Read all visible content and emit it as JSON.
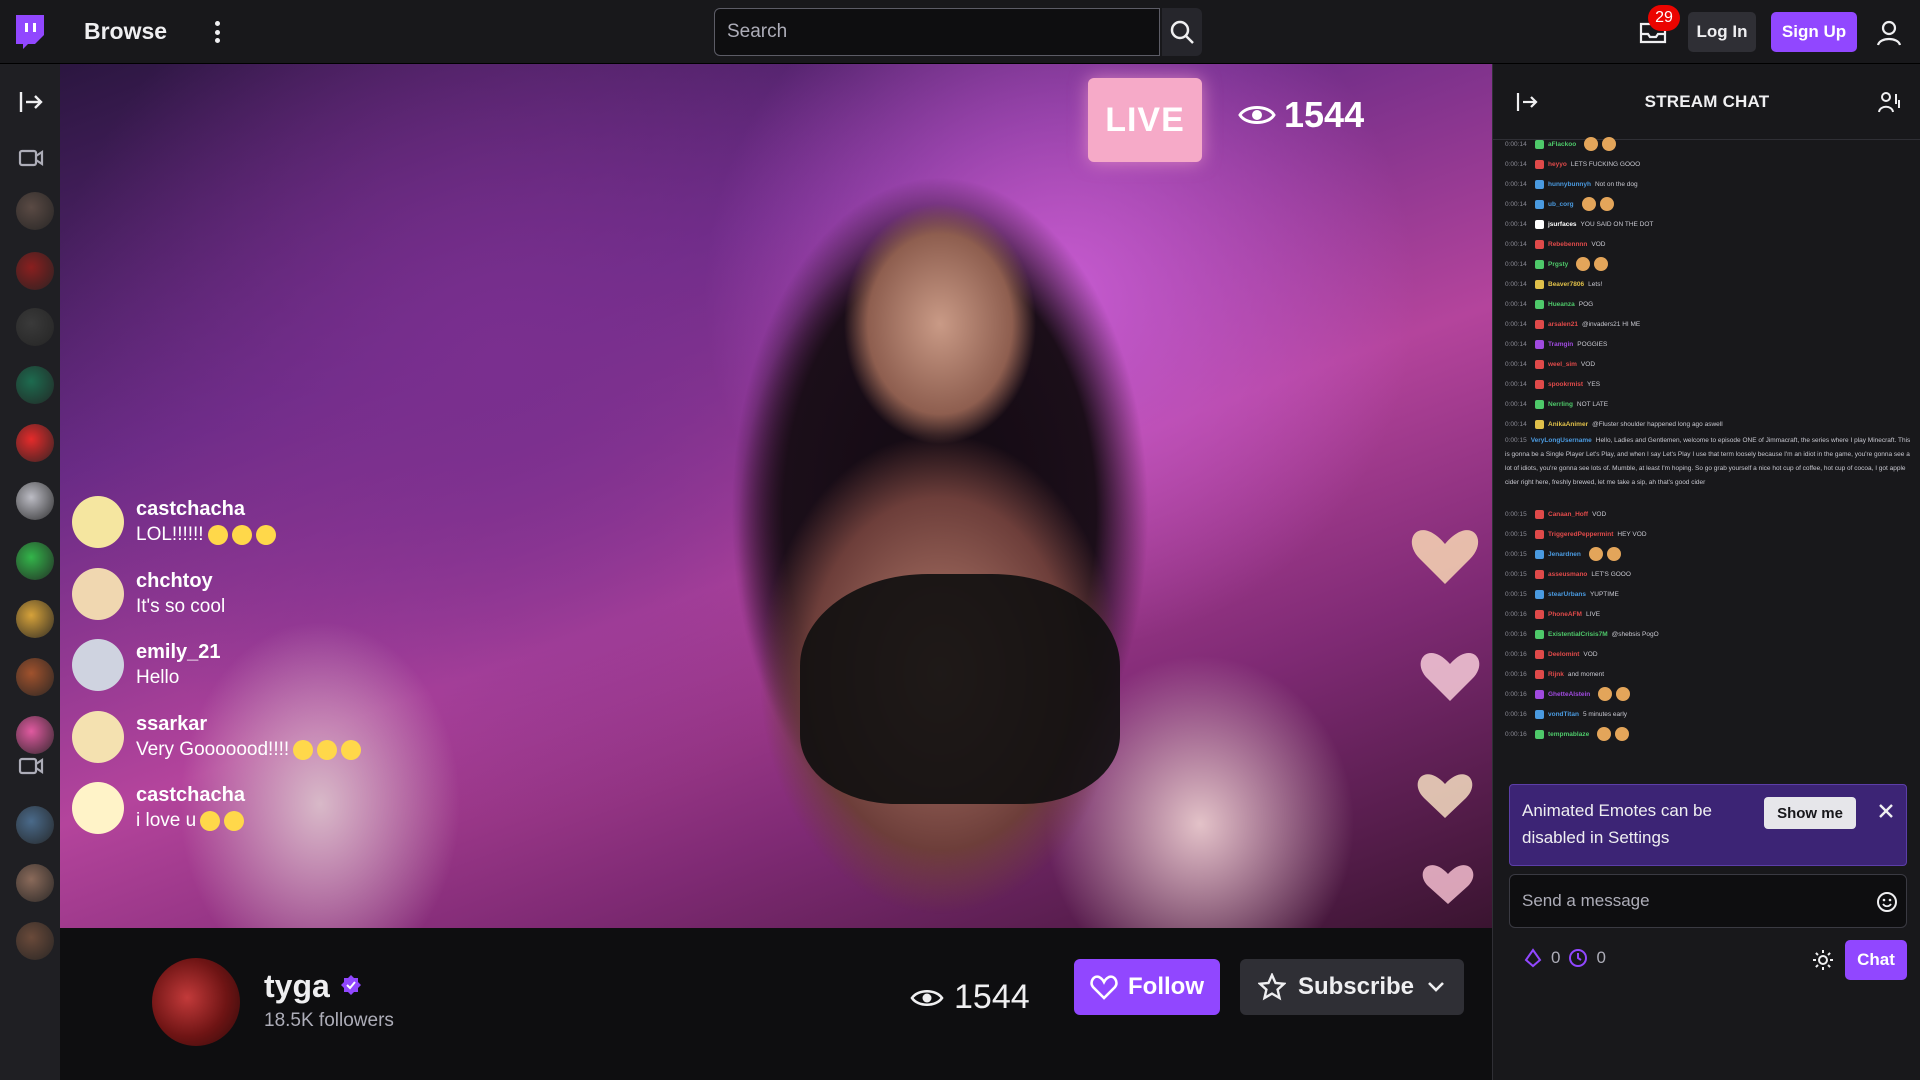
{
  "header": {
    "browse_label": "Browse",
    "search_placeholder": "Search",
    "notification_count": "29",
    "login_label": "Log In",
    "signup_label": "Sign Up"
  },
  "colors": {
    "brand": "#9147ff",
    "live": "#f6aac8",
    "badge": "#eb0400"
  },
  "sidebar": {
    "channels": [
      {
        "name": "channel-1",
        "color": "#5a4a44"
      },
      {
        "name": "channel-2",
        "color": "#8a1f1f"
      },
      {
        "name": "channel-3",
        "color": "#3a3a3a"
      },
      {
        "name": "channel-4",
        "color": "#1d6b4f"
      },
      {
        "name": "channel-5",
        "color": "#e52b2b"
      },
      {
        "name": "channel-6",
        "color": "#bcbcc4"
      },
      {
        "name": "channel-7",
        "color": "#33b54a"
      },
      {
        "name": "channel-8",
        "color": "#d6a23a"
      },
      {
        "name": "channel-9",
        "color": "#a0522d"
      },
      {
        "name": "channel-10",
        "color": "#e05aa0"
      },
      {
        "name": "channel-11",
        "color": "#4a6a8a"
      },
      {
        "name": "channel-12",
        "color": "#8a6a5a"
      },
      {
        "name": "channel-13",
        "color": "#6a4a3a"
      }
    ]
  },
  "video": {
    "live_label": "LIVE",
    "viewer_count": "1544",
    "overlay_chat": [
      {
        "user": "castchacha",
        "message": "LOL!!!!!!",
        "emotes": 3,
        "avatar": "#f5e6a0"
      },
      {
        "user": "chchtoy",
        "message": "It's so cool",
        "emotes": 0,
        "avatar": "#f0d7b0"
      },
      {
        "user": "emily_21",
        "message": "Hello",
        "emotes": 0,
        "avatar": "#cfd3e0"
      },
      {
        "user": "ssarkar",
        "message": "Very Gooooood!!!!",
        "emotes": 3,
        "avatar": "#f4e1b0"
      },
      {
        "user": "castchacha",
        "message": "i love u",
        "emotes": 2,
        "avatar": "#fff3c8"
      }
    ]
  },
  "streamer": {
    "name": "tyga",
    "followers": "18.5K followers",
    "viewer_count": "1544",
    "follow_label": "Follow",
    "subscribe_label": "Subscribe"
  },
  "chat": {
    "title": "STREAM CHAT",
    "lines": [
      {
        "ts": "0:00:14",
        "name": "aFlackoo",
        "color": "#4ec96a",
        "msg": ""
      },
      {
        "ts": "0:00:14",
        "name": "heyyo",
        "color": "#e04a4a",
        "msg": "LETS FUCKING GOOO"
      },
      {
        "ts": "0:00:14",
        "name": "hunnybunnyh",
        "color": "#4a9ae0",
        "msg": "Not on the dog"
      },
      {
        "ts": "0:00:14",
        "name": "ub_corg",
        "color": "#4a9ae0",
        "msg": ""
      },
      {
        "ts": "0:00:14",
        "name": "jsurfaces",
        "color": "#ffffff",
        "msg": "YOU SAID ON THE DOT"
      },
      {
        "ts": "0:00:14",
        "name": "Rebebennnn",
        "color": "#e04a4a",
        "msg": "VOD"
      },
      {
        "ts": "0:00:14",
        "name": "Prgsty",
        "color": "#4ec96a",
        "msg": ""
      },
      {
        "ts": "0:00:14",
        "name": "Beaver7806",
        "color": "#e0c04a",
        "msg": "Lets!"
      },
      {
        "ts": "0:00:14",
        "name": "Hueanza",
        "color": "#4ec96a",
        "msg": "POG"
      },
      {
        "ts": "0:00:14",
        "name": "arsalen21",
        "color": "#e04a4a",
        "msg": "@invaders21 HI ME"
      },
      {
        "ts": "0:00:14",
        "name": "Tramgin",
        "color": "#a04ae0",
        "msg": "POGGIES"
      },
      {
        "ts": "0:00:14",
        "name": "weel_sim",
        "color": "#e04a4a",
        "msg": "VOD"
      },
      {
        "ts": "0:00:14",
        "name": "spookrmist",
        "color": "#e04a4a",
        "msg": "YES"
      },
      {
        "ts": "0:00:14",
        "name": "Nerrling",
        "color": "#4ec96a",
        "msg": "NOT LATE"
      },
      {
        "ts": "0:00:14",
        "name": "AnikaAnimer",
        "color": "#e0c04a",
        "msg": "@Fluster shoulder happened long ago aswell"
      }
    ],
    "long_message": {
      "ts": "0:00:15",
      "name": "VeryLongUsername",
      "color": "#4a9ae0",
      "msg": "Hello, Ladies and Gentlemen, welcome to episode ONE of Jimmacraft, the series where I play Minecraft. This is gonna be a Single Player Let's Play, and when I say Let's Play I use that term loosely because I'm an idiot in the game, you're gonna see a lot of idiots, you're gonna see lots of. Mumble, at least I'm hoping. So go grab yourself a nice hot cup of coffee, hot cup of cocoa, I got apple cider right here, freshly brewed, let me take a sip, ah that's good cider"
    },
    "lines2": [
      {
        "ts": "0:00:15",
        "name": "Canaan_Hoff",
        "color": "#e04a4a",
        "msg": "VOD"
      },
      {
        "ts": "0:00:15",
        "name": "TriggeredPeppermint",
        "color": "#e04a4a",
        "msg": "HEY VOD"
      },
      {
        "ts": "0:00:15",
        "name": "Jenardnen",
        "color": "#4a9ae0",
        "msg": ""
      },
      {
        "ts": "0:00:15",
        "name": "asseusmano",
        "color": "#e04a4a",
        "msg": "LET'S GOOO"
      },
      {
        "ts": "0:00:15",
        "name": "stearUrbans",
        "color": "#4a9ae0",
        "msg": "YUPTIME"
      },
      {
        "ts": "0:00:16",
        "name": "PhoneAFM",
        "color": "#e04a4a",
        "msg": "LIVE"
      },
      {
        "ts": "0:00:16",
        "name": "ExistentialCrisis7M",
        "color": "#4ec96a",
        "msg": "@shebsis PogO"
      },
      {
        "ts": "0:00:16",
        "name": "Deelomint",
        "color": "#e04a4a",
        "msg": "VOD"
      },
      {
        "ts": "0:00:16",
        "name": "Rijnk",
        "color": "#e04a4a",
        "msg": "and moment"
      },
      {
        "ts": "0:00:16",
        "name": "GhetteAlstein",
        "color": "#a04ae0",
        "msg": ""
      },
      {
        "ts": "0:00:16",
        "name": "vondTitan",
        "color": "#4a9ae0",
        "msg": "5 minutes early"
      },
      {
        "ts": "0:00:16",
        "name": "tempmablaze",
        "color": "#4ec96a",
        "msg": ""
      }
    ],
    "notice_text": "Animated Emotes can be disabled in Settings",
    "show_me_label": "Show me",
    "input_placeholder": "Send a message",
    "points_a": "0",
    "points_b": "0",
    "chat_button": "Chat"
  }
}
